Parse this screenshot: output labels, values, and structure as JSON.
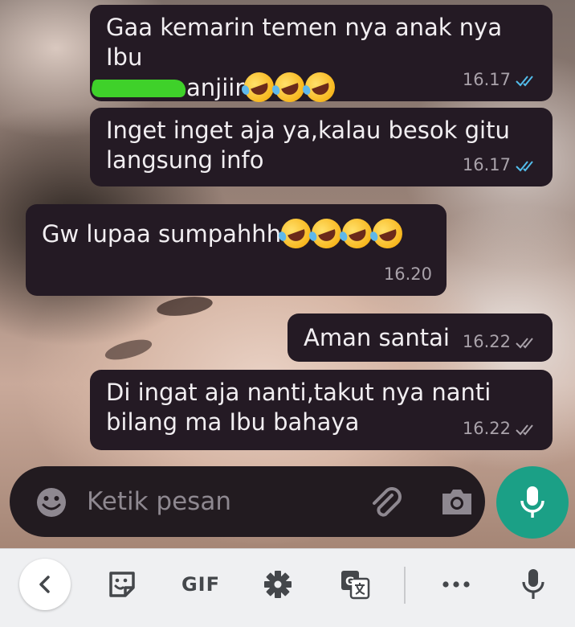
{
  "messages": [
    {
      "id": 1,
      "dir": "out",
      "lines": [
        "Gaa kemarin temen nya anak nya Ibu",
        "anjiir"
      ],
      "time": "16.17",
      "status": "read"
    },
    {
      "id": 2,
      "dir": "out",
      "lines": [
        "Inget inget aja ya,kalau besok gitu",
        "langsung info"
      ],
      "time": "16.17",
      "status": "read"
    },
    {
      "id": 3,
      "dir": "in",
      "lines": [
        "Gw lupaa sumpahhh"
      ],
      "time": "16.20"
    },
    {
      "id": 4,
      "dir": "out",
      "lines": [
        "Aman santai"
      ],
      "time": "16.22",
      "status": "delivered"
    },
    {
      "id": 5,
      "dir": "out",
      "lines": [
        "Di ingat aja nanti,takut nya nanti",
        "bilang ma Ibu bahaya"
      ],
      "time": "16.22",
      "status": "delivered"
    }
  ],
  "emoji": {
    "name": "rolling-on-floor-laughing",
    "count_msg1": 3,
    "count_msg3": 4
  },
  "redaction": {
    "color": "#3fd12a"
  },
  "composer": {
    "placeholder": "Ketik pesan",
    "icons": [
      "emoji-icon",
      "attach-icon",
      "camera-icon",
      "mic-icon"
    ],
    "fab_color": "#1ba086"
  },
  "keyboard_toolbar": {
    "gif_label": "GIF",
    "icons": [
      "back-chevron-icon",
      "sticker-icon",
      "gear-icon",
      "translate-icon",
      "more-icon",
      "voice-input-icon"
    ]
  },
  "colors": {
    "bubble": "#241a24",
    "text": "#f1eef1",
    "meta": "#a9a2aa",
    "read_ticks": "#53bdeb",
    "delivered_ticks": "#a9a2aa"
  }
}
